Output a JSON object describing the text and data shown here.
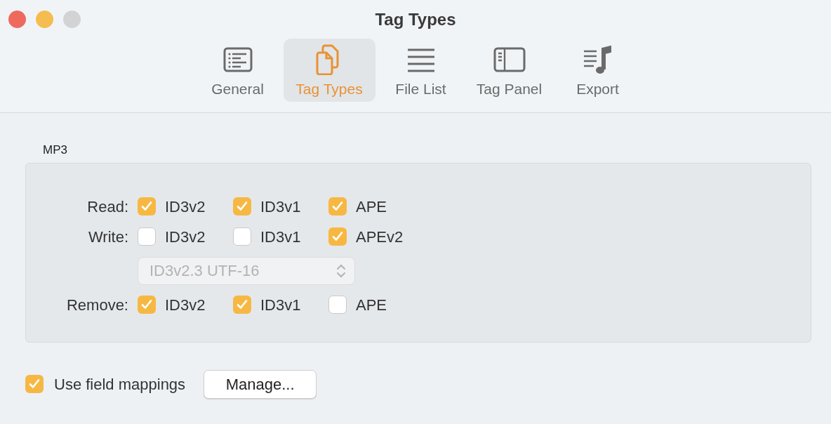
{
  "window": {
    "title": "Tag Types"
  },
  "tabs": [
    {
      "label": "General",
      "kind": "general",
      "selected": false
    },
    {
      "label": "Tag Types",
      "kind": "tagtypes",
      "selected": true
    },
    {
      "label": "File List",
      "kind": "filelist",
      "selected": false
    },
    {
      "label": "Tag Panel",
      "kind": "tagpanel",
      "selected": false
    },
    {
      "label": "Export",
      "kind": "export",
      "selected": false
    }
  ],
  "group": {
    "title": "MP3",
    "rows": [
      {
        "kind": "checks",
        "label": "Read:",
        "options": [
          {
            "label": "ID3v2",
            "checked": true
          },
          {
            "label": "ID3v1",
            "checked": true
          },
          {
            "label": "APE",
            "checked": true
          }
        ]
      },
      {
        "kind": "checks",
        "label": "Write:",
        "options": [
          {
            "label": "ID3v2",
            "checked": false
          },
          {
            "label": "ID3v1",
            "checked": false
          },
          {
            "label": "APEv2",
            "checked": true
          }
        ]
      },
      {
        "kind": "select",
        "value": "ID3v2.3 UTF-16",
        "disabled": true
      },
      {
        "kind": "checks",
        "label": "Remove:",
        "options": [
          {
            "label": "ID3v2",
            "checked": true
          },
          {
            "label": "ID3v1",
            "checked": true
          },
          {
            "label": "APE",
            "checked": false
          }
        ]
      }
    ]
  },
  "field_mappings": {
    "label": "Use field mappings",
    "checked": true,
    "button": "Manage..."
  }
}
